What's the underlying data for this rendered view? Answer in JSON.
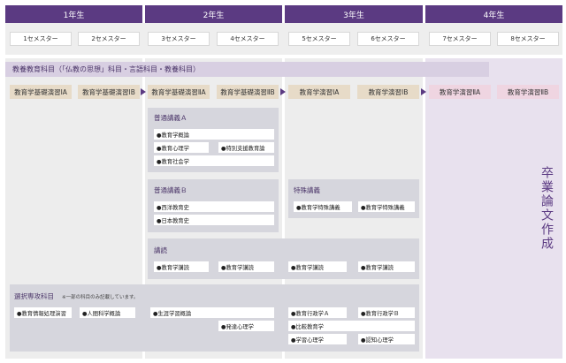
{
  "years": [
    "1年生",
    "2年生",
    "3年生",
    "4年生"
  ],
  "semesters": [
    "1セメスター",
    "2セメスター",
    "3セメスター",
    "4セメスター",
    "5セメスター",
    "6セメスター",
    "7セメスター",
    "8セメスター"
  ],
  "liberal_arts": "教養教育科目（「仏教の思想」科目・言語科目・教養科目）",
  "seminars": [
    "教育学基礎演習ⅠA",
    "教育学基礎演習ⅠB",
    "教育学基礎演習ⅡA",
    "教育学基礎演習ⅡB",
    "教育学演習ⅠA",
    "教育学演習ⅠB",
    "教育学演習ⅡA",
    "教育学演習ⅡB"
  ],
  "general_a": {
    "title": "普通講義Ａ",
    "items": [
      "●教育学概論",
      "●教育心理学",
      "●特別支援教育論",
      "●教育社会学"
    ]
  },
  "general_b": {
    "title": "普通講義Ｂ",
    "items": [
      "●西洋教育史",
      "●日本教育史"
    ]
  },
  "special": {
    "title": "特殊講義",
    "items": [
      "●教育学特殊講義",
      "●教育学特殊講義"
    ]
  },
  "reading": {
    "title": "講読",
    "items": [
      "●教育学講読",
      "●教育学講読",
      "●教育学講読",
      "●教育学講読"
    ]
  },
  "electives": {
    "title": "選択専攻科目",
    "note": "※一部の科目のみ記載しています。",
    "items": [
      "●教育情報処理演習",
      "●人間科学概論",
      "●生涯学習概論",
      "●発達心理学",
      "●教育行政学Ａ",
      "●教育行政学Ｂ",
      "●比較教育学",
      "●学習心理学",
      "●認知心理学"
    ]
  },
  "thesis": "卒業論文作成",
  "colors": {
    "header": "#5b3a82",
    "liberal": "#d8cfe2",
    "seminar_early": "#e7dbc8",
    "seminar_late": "#efd5e1"
  }
}
